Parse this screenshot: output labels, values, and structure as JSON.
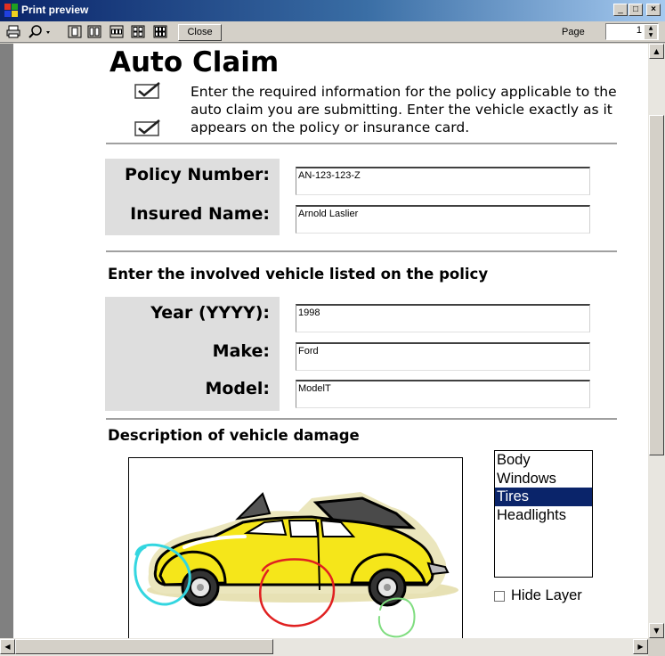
{
  "window": {
    "title": "Print preview"
  },
  "toolbar": {
    "close_label": "Close",
    "page_label": "Page",
    "page_value": "1"
  },
  "doc": {
    "title": "Auto Claim",
    "intro_lines": [
      "Enter the required information for the policy applicable to the",
      "auto claim you are submitting. Enter the vehicle exactly as it",
      "appears on the policy or insurance card."
    ],
    "policy": {
      "policy_number_label": "Policy Number:",
      "policy_number_value": "AN-123-123-Z",
      "insured_name_label": "Insured Name:",
      "insured_name_value": "Arnold Laslier"
    },
    "vehicle_heading": "Enter the involved vehicle listed on the policy",
    "vehicle": {
      "year_label": "Year (YYYY):",
      "year_value": "1998",
      "make_label": "Make:",
      "make_value": "Ford",
      "model_label": "Model:",
      "model_value": "ModelT"
    },
    "damage_heading": "Description of vehicle damage",
    "damage_options": [
      "Body",
      "Windows",
      "Tires",
      "Headlights"
    ],
    "damage_selected": "Tires",
    "hide_layer_label": "Hide Layer"
  },
  "colors": {
    "selection": "#0a246a",
    "car_body": "#f5e61a",
    "ink_cyan": "#33d6e0",
    "ink_red": "#e02020",
    "ink_green": "#80dd80"
  }
}
